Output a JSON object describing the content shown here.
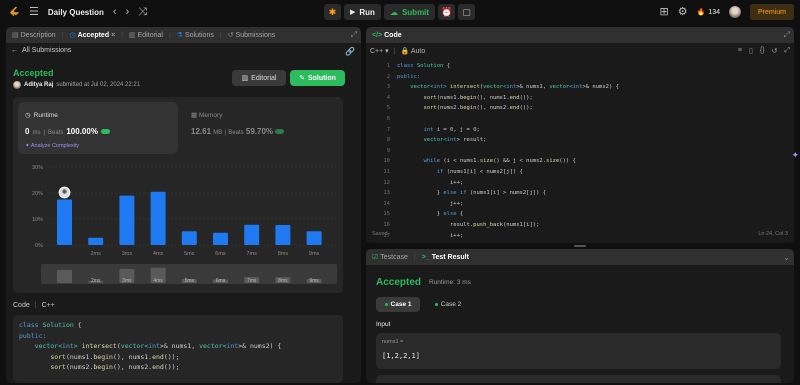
{
  "topnav": {
    "title": "Daily Question",
    "run_label": "Run",
    "submit_label": "Submit",
    "streak": "134",
    "premium_label": "Premium"
  },
  "left_tabs": {
    "description": "Description",
    "accepted": "Accepted",
    "editorial": "Editorial",
    "solutions": "Solutions",
    "submissions": "Submissions"
  },
  "submission": {
    "back_label": "All Submissions",
    "status": "Accepted",
    "user": "Aditya Raj",
    "submitted_text": "submitted at Jul 02, 2024 22:21",
    "editorial_btn": "Editorial",
    "solution_btn": "Solution",
    "runtime_title": "Runtime",
    "runtime_value": "0",
    "runtime_unit": "ms",
    "beats_label": "Beats",
    "runtime_beats": "100.00%",
    "analyze_label": "Analyze Complexity",
    "memory_title": "Memory",
    "memory_value": "12.61",
    "memory_unit": "MB",
    "memory_beats": "59.70%",
    "code_label": "Code",
    "code_lang": "C++"
  },
  "chart_data": {
    "type": "bar",
    "y_ticks": [
      "30%",
      "20%",
      "10%",
      "0%"
    ],
    "ylim": [
      0,
      30
    ],
    "categories": [
      "",
      "2ms",
      "3ms",
      "4ms",
      "5ms",
      "6ms",
      "7ms",
      "8ms",
      "9ms"
    ],
    "values": [
      17.5,
      2.8,
      19,
      20.5,
      5.3,
      4.7,
      7.8,
      7.7,
      5.3
    ],
    "highlight_index": 0,
    "bar_color": "#1f79f0",
    "axis_color": "#8a8a8a"
  },
  "left_code": [
    [
      {
        "t": "class ",
        "c": "kw"
      },
      {
        "t": "Solution ",
        "c": "ty"
      },
      {
        "t": "{",
        "c": "pl"
      }
    ],
    [
      {
        "t": "public:",
        "c": "kw"
      }
    ],
    [
      {
        "t": "    vector<",
        "c": "ty"
      },
      {
        "t": "int",
        "c": "kw"
      },
      {
        "t": "> ",
        "c": "ty"
      },
      {
        "t": "intersect",
        "c": "fn"
      },
      {
        "t": "(",
        "c": "pl"
      },
      {
        "t": "vector<",
        "c": "ty"
      },
      {
        "t": "int",
        "c": "kw"
      },
      {
        "t": ">& nums1, ",
        "c": "pl"
      },
      {
        "t": "vector<",
        "c": "ty"
      },
      {
        "t": "int",
        "c": "kw"
      },
      {
        "t": ">& nums2) {",
        "c": "pl"
      }
    ],
    [
      {
        "t": "        ",
        "c": "pl"
      },
      {
        "t": "sort",
        "c": "fn"
      },
      {
        "t": "(nums1.",
        "c": "pl"
      },
      {
        "t": "begin",
        "c": "fn"
      },
      {
        "t": "(), nums1.",
        "c": "pl"
      },
      {
        "t": "end",
        "c": "fn"
      },
      {
        "t": "());",
        "c": "pl"
      }
    ],
    [
      {
        "t": "        ",
        "c": "pl"
      },
      {
        "t": "sort",
        "c": "fn"
      },
      {
        "t": "(nums2.",
        "c": "pl"
      },
      {
        "t": "begin",
        "c": "fn"
      },
      {
        "t": "(), nums2.",
        "c": "pl"
      },
      {
        "t": "end",
        "c": "fn"
      },
      {
        "t": "());",
        "c": "pl"
      }
    ]
  ],
  "editor": {
    "tab_label": "Code",
    "lang": "C++",
    "auto_label": "Auto",
    "saved_label": "Saved",
    "cursor_pos": "Ln 24, Col 3",
    "line_numbers": [
      "1",
      "2",
      "3",
      "4",
      "5",
      "6",
      "7",
      "8",
      "9",
      "10",
      "11",
      "12",
      "13",
      "14",
      "15",
      "16",
      "17"
    ],
    "lines": [
      [
        {
          "t": "class ",
          "c": "kw"
        },
        {
          "t": "Solution ",
          "c": "ty"
        },
        {
          "t": "{",
          "c": "pl"
        }
      ],
      [
        {
          "t": "public:",
          "c": "kw"
        }
      ],
      [
        {
          "t": "    vector<",
          "c": "ty"
        },
        {
          "t": "int",
          "c": "kw"
        },
        {
          "t": "> ",
          "c": "ty"
        },
        {
          "t": "intersect",
          "c": "fn"
        },
        {
          "t": "(",
          "c": "pl"
        },
        {
          "t": "vector<",
          "c": "ty"
        },
        {
          "t": "int",
          "c": "kw"
        },
        {
          "t": ">& nums1, ",
          "c": "pl"
        },
        {
          "t": "vector<",
          "c": "ty"
        },
        {
          "t": "int",
          "c": "kw"
        },
        {
          "t": ">& nums2) {",
          "c": "pl"
        }
      ],
      [
        {
          "t": "        ",
          "c": "pl"
        },
        {
          "t": "sort",
          "c": "fn"
        },
        {
          "t": "(nums1.",
          "c": "pl"
        },
        {
          "t": "begin",
          "c": "fn"
        },
        {
          "t": "(), nums1.",
          "c": "pl"
        },
        {
          "t": "end",
          "c": "fn"
        },
        {
          "t": "());",
          "c": "pl"
        }
      ],
      [
        {
          "t": "        ",
          "c": "pl"
        },
        {
          "t": "sort",
          "c": "fn"
        },
        {
          "t": "(nums2.",
          "c": "pl"
        },
        {
          "t": "begin",
          "c": "fn"
        },
        {
          "t": "(), nums2.",
          "c": "pl"
        },
        {
          "t": "end",
          "c": "fn"
        },
        {
          "t": "());",
          "c": "pl"
        }
      ],
      [
        {
          "t": "",
          "c": "pl"
        }
      ],
      [
        {
          "t": "        ",
          "c": "pl"
        },
        {
          "t": "int ",
          "c": "kw"
        },
        {
          "t": "i = ",
          "c": "pl"
        },
        {
          "t": "0",
          "c": "nm"
        },
        {
          "t": ", j = ",
          "c": "pl"
        },
        {
          "t": "0",
          "c": "nm"
        },
        {
          "t": ";",
          "c": "pl"
        }
      ],
      [
        {
          "t": "        vector<",
          "c": "ty"
        },
        {
          "t": "int",
          "c": "kw"
        },
        {
          "t": "> result;",
          "c": "pl"
        }
      ],
      [
        {
          "t": "",
          "c": "pl"
        }
      ],
      [
        {
          "t": "        ",
          "c": "pl"
        },
        {
          "t": "while ",
          "c": "kw"
        },
        {
          "t": "(i < nums1.",
          "c": "pl"
        },
        {
          "t": "size",
          "c": "fn"
        },
        {
          "t": "() && j < nums2.",
          "c": "pl"
        },
        {
          "t": "size",
          "c": "fn"
        },
        {
          "t": "()) {",
          "c": "pl"
        }
      ],
      [
        {
          "t": "            ",
          "c": "pl"
        },
        {
          "t": "if ",
          "c": "kw"
        },
        {
          "t": "(nums1[i] < nums2[j]) {",
          "c": "pl"
        }
      ],
      [
        {
          "t": "                i++;",
          "c": "pl"
        }
      ],
      [
        {
          "t": "            } ",
          "c": "pl"
        },
        {
          "t": "else if ",
          "c": "kw"
        },
        {
          "t": "(nums1[i] > nums2[j]) {",
          "c": "pl"
        }
      ],
      [
        {
          "t": "                j++;",
          "c": "pl"
        }
      ],
      [
        {
          "t": "            } ",
          "c": "pl"
        },
        {
          "t": "else ",
          "c": "kw"
        },
        {
          "t": "{",
          "c": "pl"
        }
      ],
      [
        {
          "t": "                result.",
          "c": "pl"
        },
        {
          "t": "push_back",
          "c": "fn"
        },
        {
          "t": "(nums1[i]);",
          "c": "pl"
        }
      ],
      [
        {
          "t": "                i++;",
          "c": "pl"
        }
      ]
    ]
  },
  "test": {
    "testcase_tab": "Testcase",
    "result_tab": "Test Result",
    "status": "Accepted",
    "runtime_text": "Runtime: 3 ms",
    "case1": "Case 1",
    "case2": "Case 2",
    "input_label": "Input",
    "param_name": "nums1 =",
    "param_value": "[1,2,2,1]"
  }
}
